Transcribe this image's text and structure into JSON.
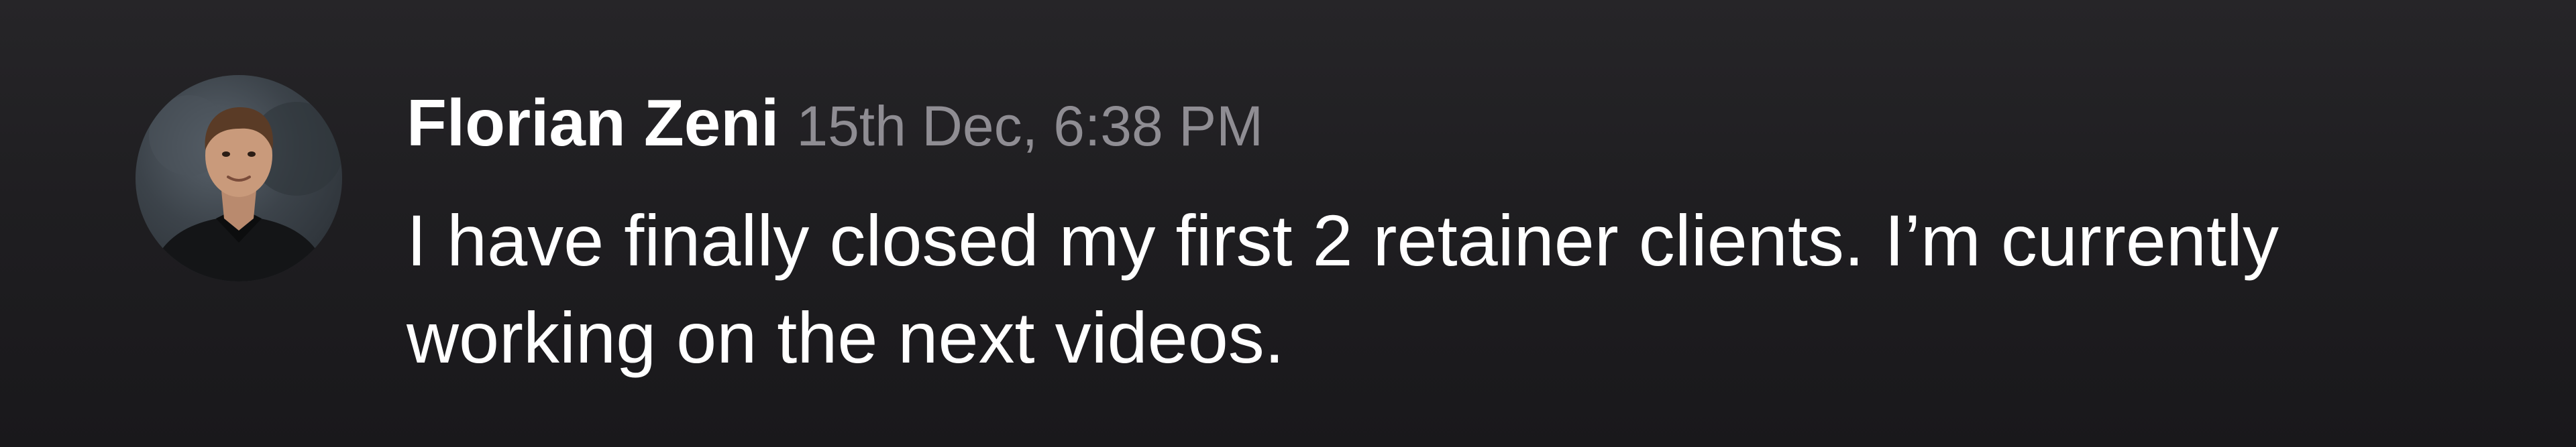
{
  "message": {
    "author": "Florian Zeni",
    "timestamp": "15th Dec, 6:38 PM",
    "text_line_1": "I have finally closed my first 2 retainer clients. I’m currently",
    "text_line_2": "working on the next videos.",
    "avatar_icon": "user-avatar-photo"
  },
  "colors": {
    "background": "#1f1e21",
    "author_text": "#ffffff",
    "timestamp_text": "#8f8d93",
    "body_text": "#ffffff"
  }
}
